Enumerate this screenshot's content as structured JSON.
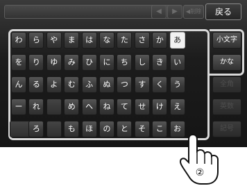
{
  "topbar": {
    "input_value": "",
    "prev_label": "◀",
    "next_label": "▶",
    "clear_label": "◀削除",
    "back_label": "戻る"
  },
  "keyboard": {
    "rows": [
      [
        "わ",
        "ら",
        "や",
        "ま",
        "は",
        "な",
        "た",
        "さ",
        "か",
        "あ"
      ],
      [
        "を",
        "り",
        "ゆ",
        "み",
        "ひ",
        "に",
        "ち",
        "し",
        "き",
        "い"
      ],
      [
        "ん",
        "る",
        "よ",
        "む",
        "ふ",
        "ぬ",
        "つ",
        "す",
        "く",
        "う"
      ],
      [
        "ー",
        "れ",
        "",
        "め",
        "へ",
        "ね",
        "て",
        "せ",
        "け",
        "え"
      ],
      [
        "",
        "ろ",
        "",
        "も",
        "ほ",
        "の",
        "と",
        "そ",
        "こ",
        "お"
      ]
    ],
    "selected_key": "あ"
  },
  "modes": {
    "small_label": "小文字",
    "kana_label": "かな",
    "dim_labels": [
      "全角",
      "英数",
      "記号"
    ]
  },
  "callout": {
    "number": "②",
    "icon": "pointing-hand-icon"
  },
  "colors": {
    "panel": "#1c1c1c",
    "highlight_outline": "#d8d8d8",
    "key_text": "#ffffff",
    "selected_key_bg": "#f2f2f2"
  }
}
